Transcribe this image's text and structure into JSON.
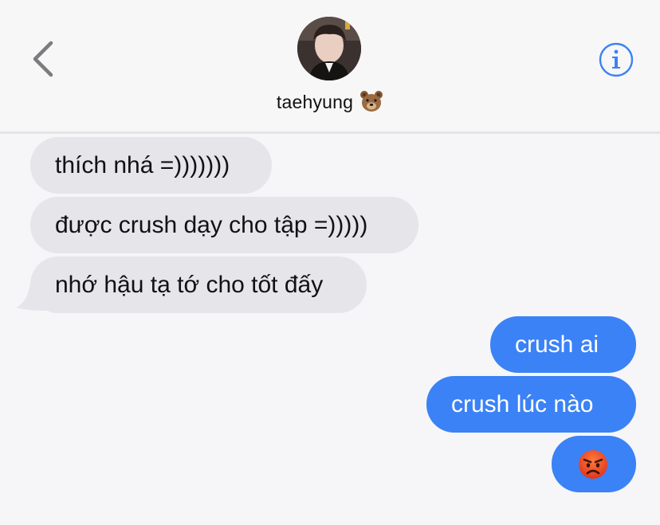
{
  "contact": {
    "name": "taehyung"
  },
  "icons": {
    "back": "chevron-left-icon",
    "info": "info-icon",
    "name_badge": "bear-face-icon",
    "last_message": "angry-face-icon"
  },
  "colors": {
    "accent": "#3b82f6",
    "incoming_bubble": "#e6e5ea",
    "background": "#f6f6f8"
  },
  "messages": [
    {
      "direction": "incoming",
      "text": "thích nhá =)))))))"
    },
    {
      "direction": "incoming",
      "text": "được crush dạy cho tập =)))))"
    },
    {
      "direction": "incoming",
      "text": "nhớ hậu tạ tớ cho tốt đấy"
    },
    {
      "direction": "outgoing",
      "text": "crush ai"
    },
    {
      "direction": "outgoing",
      "text": "crush lúc nào"
    },
    {
      "direction": "outgoing",
      "text": ""
    }
  ]
}
